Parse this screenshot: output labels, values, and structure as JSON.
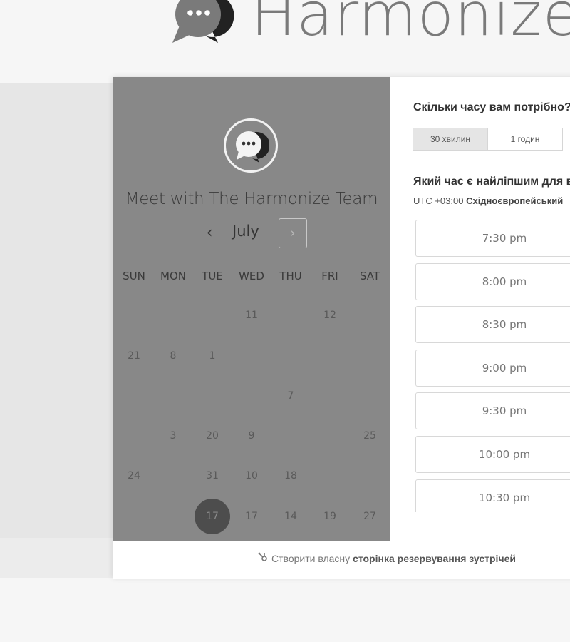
{
  "brand": {
    "name": "Harmonize",
    "logo_icon": "chat-bubble-ellipsis-icon"
  },
  "calendar": {
    "avatar_icon": "chat-bubble-ellipsis-icon",
    "title": "Meet with The Harmonize Team",
    "month": "July",
    "prev_label": "‹",
    "next_label": "›",
    "weekdays": [
      "SUN",
      "MON",
      "TUE",
      "WED",
      "THU",
      "FRI",
      "SAT"
    ],
    "days": [
      {
        "label": "11",
        "row": 0,
        "col": 3
      },
      {
        "label": "12",
        "row": 0,
        "col": 5
      },
      {
        "label": "21",
        "row": 1,
        "col": 0
      },
      {
        "label": "8",
        "row": 1,
        "col": 1
      },
      {
        "label": "1",
        "row": 1,
        "col": 2
      },
      {
        "label": "7",
        "row": 2,
        "col": 4
      },
      {
        "label": "3",
        "row": 3,
        "col": 1
      },
      {
        "label": "20",
        "row": 3,
        "col": 2
      },
      {
        "label": "9",
        "row": 3,
        "col": 3
      },
      {
        "label": "25",
        "row": 3,
        "col": 6
      },
      {
        "label": "24",
        "row": 4,
        "col": 0
      },
      {
        "label": "31",
        "row": 4,
        "col": 2
      },
      {
        "label": "10",
        "row": 4,
        "col": 3
      },
      {
        "label": "18",
        "row": 4,
        "col": 4
      },
      {
        "label": "17",
        "row": 5,
        "col": 2,
        "selected": true
      },
      {
        "label": "17",
        "row": 5,
        "col": 3
      },
      {
        "label": "14",
        "row": 5,
        "col": 4
      },
      {
        "label": "19",
        "row": 5,
        "col": 5
      },
      {
        "label": "27",
        "row": 5,
        "col": 6
      }
    ]
  },
  "booking": {
    "duration_question": "Скільки часу вам потрібно?",
    "durations": [
      {
        "label": "30 хвилин",
        "active": true
      },
      {
        "label": "1 годин",
        "active": false
      }
    ],
    "time_question": "Який час є найліпшим для ва",
    "timezone_offset": "UTC +03:00",
    "timezone_name": "Східноєвропейський",
    "slots": [
      "7:30 pm",
      "8:00 pm",
      "8:30 pm",
      "9:00 pm",
      "9:30 pm",
      "10:00 pm",
      "10:30 pm"
    ]
  },
  "footer": {
    "icon": "sprocket-icon",
    "text_prefix": "Створити власну",
    "text_bold": "сторінка резервування зустрічей"
  }
}
